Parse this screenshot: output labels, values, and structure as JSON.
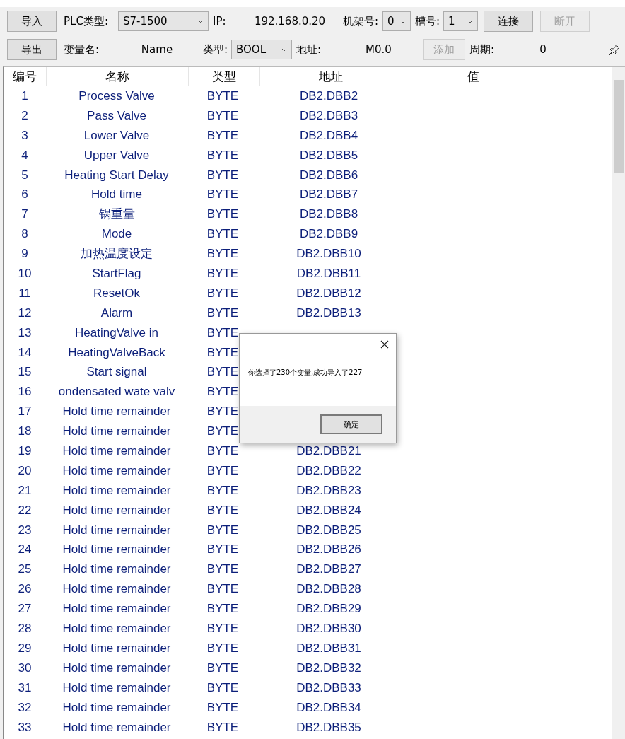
{
  "toolbar": {
    "import_button": "导入",
    "plc_type_label": "PLC类型:",
    "plc_type": "S7-1500",
    "ip_label": "IP:",
    "ip": "192.168.0.20",
    "rack_label": "机架号:",
    "rack": "0",
    "slot_label": "槽号:",
    "slot": "1",
    "connect_button": "连接",
    "disconnect_button": {
      "label": "断开",
      "disabled": true
    },
    "export_button": "导出",
    "var_name_label": "变量名:",
    "var_name": "Name",
    "type_label": "类型:",
    "type": "BOOL",
    "address_label": "地址:",
    "address": "M0.0",
    "add_button": {
      "label": "添加",
      "disabled": true
    },
    "period_label": "周期:",
    "period": "0"
  },
  "table": {
    "columns": [
      "编号",
      "名称",
      "类型",
      "地址",
      "值"
    ],
    "rows": [
      {
        "number": "1",
        "name": "Process Valve",
        "type": "BYTE",
        "address": "DB2.DBB2"
      },
      {
        "number": "2",
        "name": "Pass Valve",
        "type": "BYTE",
        "address": "DB2.DBB3"
      },
      {
        "number": "3",
        "name": "Lower Valve",
        "type": "BYTE",
        "address": "DB2.DBB4"
      },
      {
        "number": "4",
        "name": "Upper Valve",
        "type": "BYTE",
        "address": "DB2.DBB5"
      },
      {
        "number": "5",
        "name": "Heating Start Delay",
        "type": "BYTE",
        "address": "DB2.DBB6"
      },
      {
        "number": "6",
        "name": "Hold time",
        "type": "BYTE",
        "address": "DB2.DBB7"
      },
      {
        "number": "7",
        "name": "锅重量",
        "type": "BYTE",
        "address": "DB2.DBB8"
      },
      {
        "number": "8",
        "name": "Mode",
        "type": "BYTE",
        "address": "DB2.DBB9"
      },
      {
        "number": "9",
        "name": "加热温度设定",
        "type": "BYTE",
        "address": "DB2.DBB10"
      },
      {
        "number": "10",
        "name": "StartFlag",
        "type": "BYTE",
        "address": "DB2.DBB11"
      },
      {
        "number": "11",
        "name": "ResetOk",
        "type": "BYTE",
        "address": "DB2.DBB12"
      },
      {
        "number": "12",
        "name": "Alarm",
        "type": "BYTE",
        "address": "DB2.DBB13"
      },
      {
        "number": "13",
        "name": "HeatingValve in",
        "type": "BYTE"
      },
      {
        "number": "14",
        "name": "HeatingValveBack",
        "type": "BYTE"
      },
      {
        "number": "15",
        "name": "Start signal",
        "type": "BYTE"
      },
      {
        "number": "16",
        "name": "ondensated wate valv",
        "type": "BYTE"
      },
      {
        "number": "17",
        "name": "Hold time remainder",
        "type": "BYTE"
      },
      {
        "number": "18",
        "name": "Hold time remainder",
        "type": "BYTE"
      },
      {
        "number": "19",
        "name": "Hold time remainder",
        "type": "BYTE",
        "address": "DB2.DBB21"
      },
      {
        "number": "20",
        "name": "Hold time remainder",
        "type": "BYTE",
        "address": "DB2.DBB22"
      },
      {
        "number": "21",
        "name": "Hold time remainder",
        "type": "BYTE",
        "address": "DB2.DBB23"
      },
      {
        "number": "22",
        "name": "Hold time remainder",
        "type": "BYTE",
        "address": "DB2.DBB24"
      },
      {
        "number": "23",
        "name": "Hold time remainder",
        "type": "BYTE",
        "address": "DB2.DBB25"
      },
      {
        "number": "24",
        "name": "Hold time remainder",
        "type": "BYTE",
        "address": "DB2.DBB26"
      },
      {
        "number": "25",
        "name": "Hold time remainder",
        "type": "BYTE",
        "address": "DB2.DBB27"
      },
      {
        "number": "26",
        "name": "Hold time remainder",
        "type": "BYTE",
        "address": "DB2.DBB28"
      },
      {
        "number": "27",
        "name": "Hold time remainder",
        "type": "BYTE",
        "address": "DB2.DBB29"
      },
      {
        "number": "28",
        "name": "Hold time remainder",
        "type": "BYTE",
        "address": "DB2.DBB30"
      },
      {
        "number": "29",
        "name": "Hold time remainder",
        "type": "BYTE",
        "address": "DB2.DBB31"
      },
      {
        "number": "30",
        "name": "Hold time remainder",
        "type": "BYTE",
        "address": "DB2.DBB32"
      },
      {
        "number": "31",
        "name": "Hold time remainder",
        "type": "BYTE",
        "address": "DB2.DBB33"
      },
      {
        "number": "32",
        "name": "Hold time remainder",
        "type": "BYTE",
        "address": "DB2.DBB34"
      },
      {
        "number": "33",
        "name": "Hold time remainder",
        "type": "BYTE",
        "address": "DB2.DBB35"
      }
    ]
  },
  "dialog": {
    "message": "你选择了230个变量,成功导入了227",
    "ok_button": "确定"
  }
}
